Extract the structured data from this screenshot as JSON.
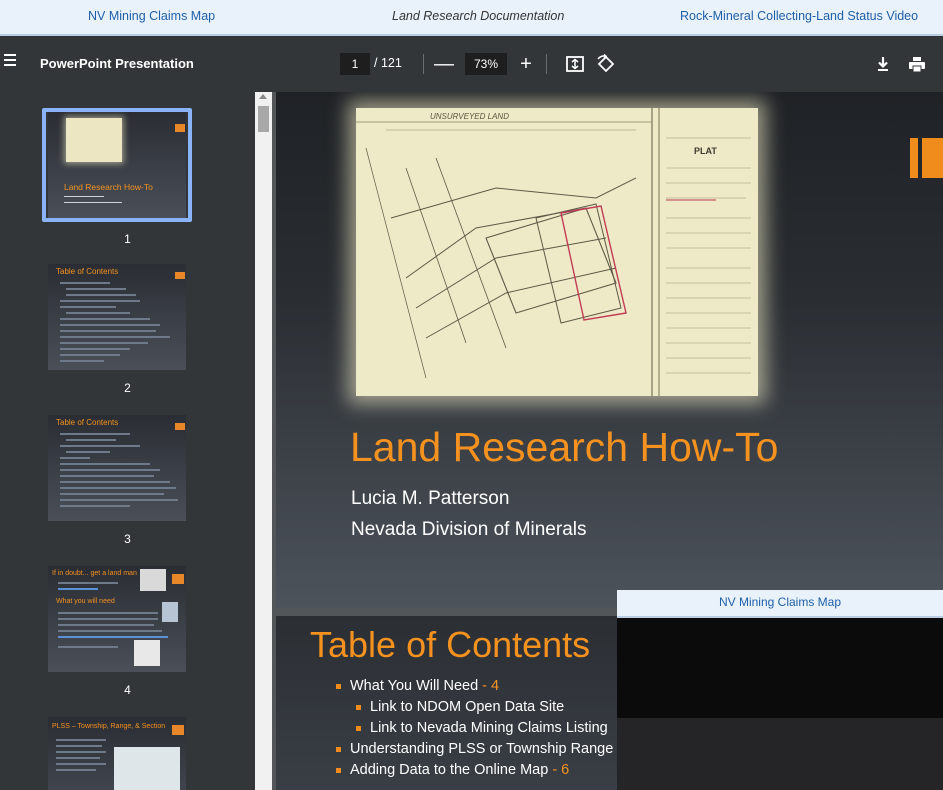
{
  "tabs": {
    "left": "NV Mining Claims Map",
    "middle": "Land Research Documentation",
    "right": "Rock-Mineral Collecting-Land Status Video"
  },
  "toolbar": {
    "title": "PowerPoint Presentation",
    "page_current": "1",
    "page_total": "/ 121",
    "zoom_out": "—",
    "zoom": "73%",
    "zoom_in": "+",
    "icons": [
      "menu-icon",
      "fit-page-icon",
      "rotate-icon",
      "download-icon",
      "print-icon"
    ]
  },
  "thumbnails": [
    {
      "number": "1",
      "title": "Land Research How-To",
      "selected": true
    },
    {
      "number": "2",
      "title": "Table of Contents"
    },
    {
      "number": "3",
      "title": "Table of Contents"
    },
    {
      "number": "4",
      "title": "If in doubt... get a land man"
    },
    {
      "number": "5",
      "title": "PLSS – Township, Range, & Section"
    }
  ],
  "slide1": {
    "plat_header": "UNSURVEYED LAND",
    "plat_label": "PLAT",
    "title": "Land Research How-To",
    "author": "Lucia M. Patterson",
    "organization": "Nevada Division of Minerals"
  },
  "slide2": {
    "title": "Table of Contents",
    "items": [
      {
        "text": "What You Will Need",
        "page": " - 4",
        "level": 1
      },
      {
        "text": "Link to NDOM Open Data Site",
        "page": "",
        "level": 2
      },
      {
        "text": "Link to Nevada Mining Claims Listing",
        "page": "",
        "level": 2
      },
      {
        "text": "Understanding PLSS or Township Range",
        "page": "",
        "level": 1
      },
      {
        "text": "Adding Data to the Online Map",
        "page": " - 6",
        "level": 1
      }
    ]
  },
  "overlay": {
    "title": "NV Mining Claims Map"
  },
  "colors": {
    "accent_orange": "#f5921f",
    "selection_blue": "#8ab4f8",
    "tab_link_blue": "#1f5fa8"
  }
}
